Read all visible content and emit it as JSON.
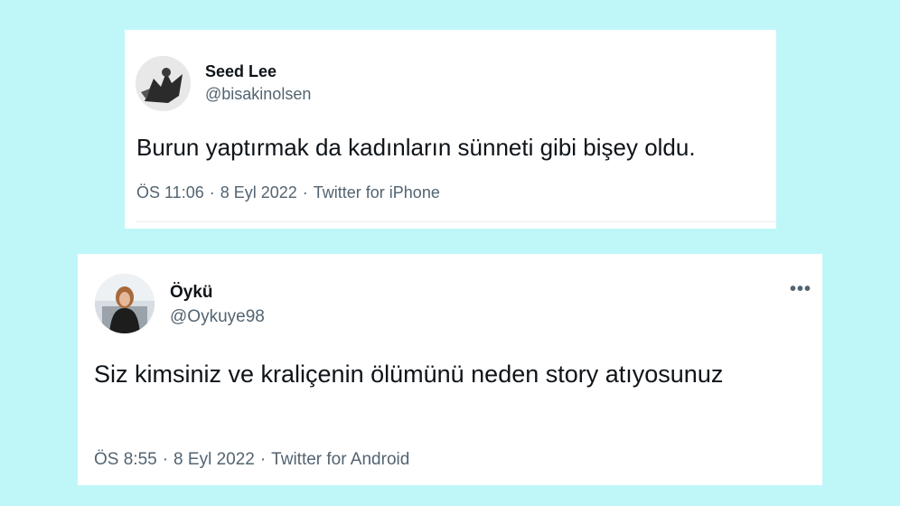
{
  "tweets": [
    {
      "display_name": "Seed Lee",
      "handle": "@bisakinolsen",
      "text": "Burun yaptırmak da kadınların sünneti gibi bişey oldu.",
      "time": "ÖS 11:06",
      "date": "8 Eyl 2022",
      "source": "Twitter for iPhone",
      "separator": "·"
    },
    {
      "display_name": "Öykü",
      "handle": "@Oykuye98",
      "text": "Siz kimsiniz ve kraliçenin ölümünü neden story atıyosunuz",
      "time": "ÖS 8:55",
      "date": "8 Eyl 2022",
      "source": "Twitter for Android",
      "separator": "·",
      "more_icon": "•••"
    }
  ],
  "colors": {
    "background": "#bff7f9",
    "card": "#ffffff",
    "secondary_text": "#536471",
    "primary_text": "#0f1419"
  }
}
